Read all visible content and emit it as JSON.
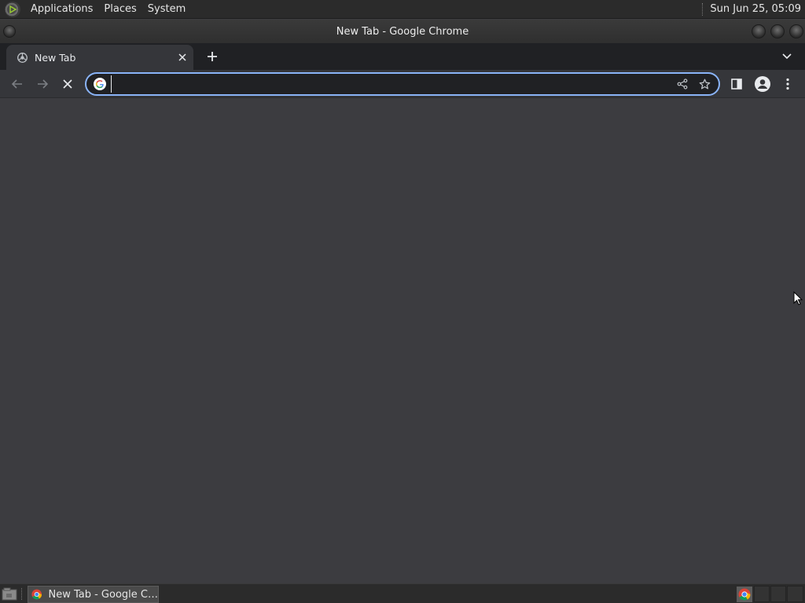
{
  "top_panel": {
    "menus": [
      "Applications",
      "Places",
      "System"
    ],
    "clock": "Sun Jun 25, 05:09"
  },
  "window": {
    "title": "New Tab - Google Chrome"
  },
  "tabs": [
    {
      "title": "New Tab",
      "active": true,
      "favicon": "chrome-newtab-icon"
    }
  ],
  "toolbar": {
    "back_icon": "arrow-left-icon",
    "forward_icon": "arrow-right-icon",
    "stop_icon": "close-icon",
    "omnibox": {
      "value": "",
      "placeholder": "",
      "engine_icon": "google-g-icon"
    },
    "actions": [
      "share-icon",
      "star-icon",
      "side-panel-icon",
      "profile-icon",
      "kebab-menu-icon"
    ]
  },
  "taskbar": {
    "items": [
      {
        "label": "New Tab - Google C…",
        "icon": "chrome-icon"
      }
    ]
  },
  "colors": {
    "panel_bg": "#2b2b2b",
    "tabstrip_bg": "#202124",
    "toolbar_bg": "#35363a",
    "content_bg": "#3c3c40",
    "omnibox_focus": "#8ab4f8",
    "text": "#e8eaed"
  }
}
